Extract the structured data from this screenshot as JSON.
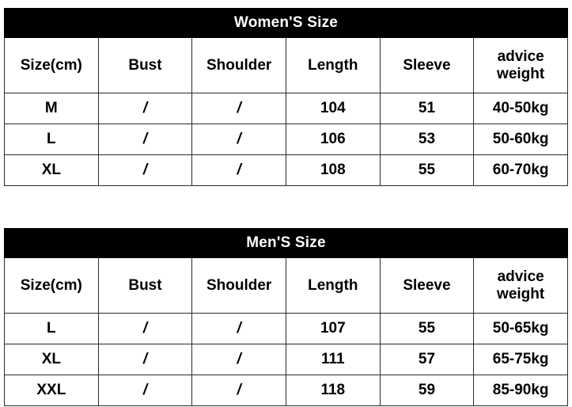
{
  "document": {
    "type": "garment-size-chart",
    "background_color": "#ffffff",
    "title_band_color": "#000000",
    "title_text_color": "#ffffff",
    "grid_line_color": "#2b2b2b",
    "text_color": "#000000"
  },
  "tables": [
    {
      "id": "womens",
      "title": "Women'S Size",
      "columns": [
        "Size(cm)",
        "Bust",
        "Shoulder",
        "Length",
        "Sleeve",
        "advice weight"
      ],
      "rows": [
        {
          "size": "M",
          "bust": "/",
          "shoulder": "/",
          "length": "104",
          "sleeve": "51",
          "advice_weight": "40-50kg"
        },
        {
          "size": "L",
          "bust": "/",
          "shoulder": "/",
          "length": "106",
          "sleeve": "53",
          "advice_weight": "50-60kg"
        },
        {
          "size": "XL",
          "bust": "/",
          "shoulder": "/",
          "length": "108",
          "sleeve": "55",
          "advice_weight": "60-70kg"
        }
      ]
    },
    {
      "id": "mens",
      "title": "Men'S Size",
      "columns": [
        "Size(cm)",
        "Bust",
        "Shoulder",
        "Length",
        "Sleeve",
        "advice weight"
      ],
      "rows": [
        {
          "size": "L",
          "bust": "/",
          "shoulder": "/",
          "length": "107",
          "sleeve": "55",
          "advice_weight": "50-65kg"
        },
        {
          "size": "XL",
          "bust": "/",
          "shoulder": "/",
          "length": "111",
          "sleeve": "57",
          "advice_weight": "65-75kg"
        },
        {
          "size": "XXL",
          "bust": "/",
          "shoulder": "/",
          "length": "118",
          "sleeve": "59",
          "advice_weight": "85-90kg"
        }
      ]
    }
  ]
}
